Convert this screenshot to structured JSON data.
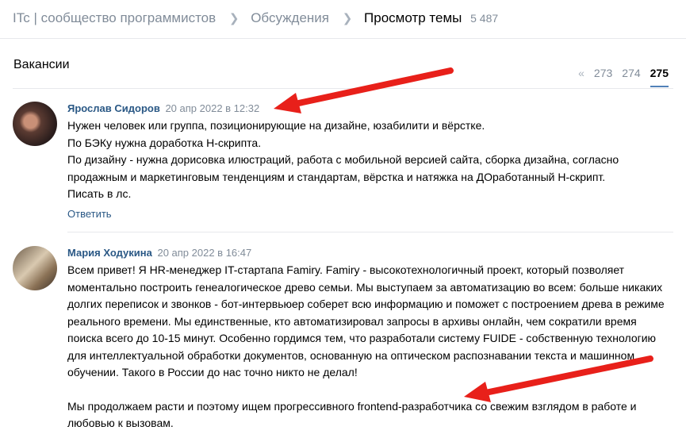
{
  "breadcrumb": {
    "community": "ITc | сообщество программистов",
    "discussions": "Обсуждения",
    "current": "Просмотр темы",
    "count": "5 487"
  },
  "topic": {
    "title": "Вакансии"
  },
  "pagination": {
    "prev": "«",
    "pages": [
      "273",
      "274",
      "275"
    ],
    "active": "275"
  },
  "posts": [
    {
      "author": "Ярослав Сидоров",
      "date": "20 апр 2022 в 12:32",
      "lines": [
        "Нужен человек или группа, позиционирующие на дизайне, юзабилити и вёрстке.",
        "По БЭКу нужна доработка Н-скрипта.",
        "По дизайну - нужна дорисовка илюстраций, работа с мобильной версией сайта, сборка дизайна, согласно продажным и маркетинговым тенденциям и стандартам, вёрстка и натяжка на ДОработанный Н-скрипт.",
        "Писать в лс."
      ],
      "reply": "Ответить"
    },
    {
      "author": "Мария Ходукина",
      "date": "20 апр 2022 в 16:47",
      "paragraph1": "Всем привет! Я HR-менеджер IT-стартапа Famiry. Famiry - высокотехнологичный проект, который позволяет моментально построить генеалогическое древо семьи. Мы выступаем за автоматизацию во всем: больше никаких долгих переписок и звонков - бот-интервьюер соберет всю информацию и поможет с построением древа в режиме реального времени. Мы единственные, кто автоматизировал запросы в архивы онлайн, чем сократили время поиска всего до 10-15 минут. Особенно гордимся тем, что разработали систему FUIDE - собственную технологию для интеллектуальной обработки документов, основанную на оптическом распознавании текста и машинном обучении. Такого в России до нас точно никто не делал!",
      "paragraph2": "Мы продолжаем расти и поэтому ищем прогрессивного frontend-разработчика со свежим взглядом в работе и любовью к вызовам."
    }
  ],
  "colors": {
    "link": "#2a5885",
    "muted": "#818c99",
    "arrow": "#e8201a",
    "pager_underline": "#5181b8"
  },
  "icons": {
    "separator": "chevron-right-icon",
    "annotation": "red-arrow"
  }
}
